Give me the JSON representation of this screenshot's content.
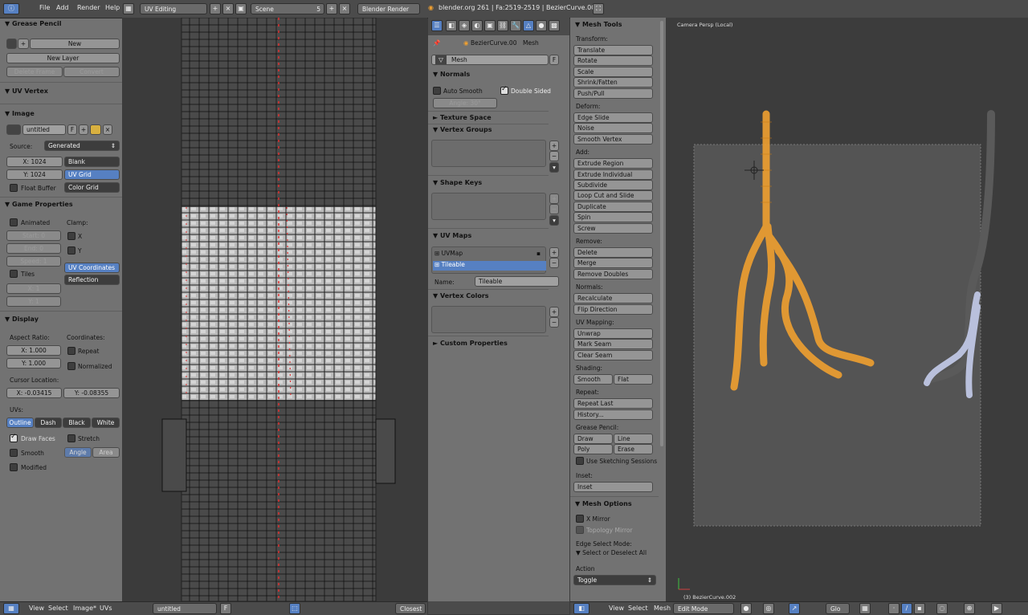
{
  "topbar": {
    "menus": [
      "File",
      "Add",
      "Render",
      "Help"
    ],
    "screen_layout": "UV Editing",
    "scene": "Scene",
    "scene_users": "5",
    "render_engine": "Blender Render",
    "stats": "blender.org 261 | Fa:2519-2519 | BezierCurve.002"
  },
  "uv_tools": {
    "grease_pencil": {
      "header": "▼ Grease Pencil",
      "new": "New",
      "new_layer": "New Layer",
      "delete_frame": "Delete Frame",
      "convert": "Convert"
    },
    "uv_vertex": {
      "header": "▼ UV Vertex"
    },
    "image": {
      "header": "▼ Image",
      "name": "untitled",
      "f": "F",
      "source_label": "Source:",
      "source_value": "Generated",
      "x": "X: 1024",
      "y": "Y: 1024",
      "types": [
        "Blank",
        "UV Grid",
        "Color Grid"
      ],
      "float_buffer": "Float Buffer"
    },
    "game_properties": {
      "header": "▼ Game Properties",
      "animated": "Animated",
      "clamp": "Clamp:",
      "start": "Start: 0",
      "end": "End: 0",
      "speed": "Speed: 1",
      "x": "X",
      "y": "Y",
      "uv_coordinates": "UV Coordinates",
      "reflection": "Reflection",
      "tiles": "Tiles",
      "tx": "X: 1",
      "ty": "Y: 1"
    },
    "display": {
      "header": "▼ Display",
      "aspect_ratio": "Aspect Ratio:",
      "coordinates": "Coordinates:",
      "ax": "X: 1.000",
      "ay": "Y: 1.000",
      "repeat": "Repeat",
      "normalized": "Normalized",
      "cursor_location": "Cursor Location:",
      "cx": "X: -0.03415",
      "cy": "Y: -0.08355",
      "uvs": "UVs:",
      "styles": [
        "Outline",
        "Dash",
        "Black",
        "White"
      ],
      "draw_faces": "Draw Faces",
      "stretch": "Stretch",
      "smooth": "Smooth",
      "angle": "Angle",
      "area": "Area",
      "modified": "Modified"
    }
  },
  "uv_header": {
    "menus": [
      "View",
      "Select",
      "Image*",
      "UVs"
    ],
    "image": "untitled",
    "f": "F",
    "snap": "Closest"
  },
  "properties": {
    "breadcrumb": [
      "BezierCurve.00",
      "Mesh"
    ],
    "datablock": "Mesh",
    "f": "F",
    "normals": {
      "header": "▼ Normals",
      "auto_smooth": "Auto Smooth",
      "double_sided": "Double Sided",
      "angle": "Angle: 30°"
    },
    "texture_space": "► Texture Space",
    "vertex_groups": "▼ Vertex Groups",
    "shape_keys": "▼ Shape Keys",
    "uv_maps": {
      "header": "▼ UV Maps",
      "items": [
        "UVMap",
        "Tileable"
      ],
      "name_label": "Name:",
      "name_value": "Tileable"
    },
    "vertex_colors": "▼ Vertex Colors",
    "custom_properties": "► Custom Properties"
  },
  "mesh_tools": {
    "header": "▼ Mesh Tools",
    "transform_label": "Transform:",
    "transform": [
      "Translate",
      "Rotate",
      "Scale",
      "Shrink/Fatten",
      "Push/Pull"
    ],
    "deform_label": "Deform:",
    "deform": [
      "Edge Slide",
      "Noise",
      "Smooth Vertex"
    ],
    "add_label": "Add:",
    "add": [
      "Extrude Region",
      "Extrude Individual",
      "Subdivide",
      "Loop Cut and Slide",
      "Duplicate",
      "Spin",
      "Screw"
    ],
    "remove_label": "Remove:",
    "remove": [
      "Delete",
      "Merge",
      "Remove Doubles"
    ],
    "normals_label": "Normals:",
    "normals": [
      "Recalculate",
      "Flip Direction"
    ],
    "uv_mapping_label": "UV Mapping:",
    "uv_mapping": [
      "Unwrap",
      "Mark Seam",
      "Clear Seam"
    ],
    "shading_label": "Shading:",
    "shading": [
      "Smooth",
      "Flat"
    ],
    "repeat_label": "Repeat:",
    "repeat": [
      "Repeat Last",
      "History..."
    ],
    "grease_label": "Grease Pencil:",
    "grease": [
      "Draw",
      "Line",
      "Poly",
      "Erase"
    ],
    "sketching": "Use Sketching Sessions",
    "inset_label": "Inset:",
    "inset": "Inset",
    "mesh_options": "▼ Mesh Options",
    "x_mirror": "X Mirror",
    "topology_mirror": "Topology Mirror",
    "edge_select_mode": "Edge Select Mode:",
    "select_deselect": "▼ Select or Deselect All",
    "action_label": "Action",
    "action_value": "Toggle"
  },
  "viewport": {
    "title": "Camera Persp (Local)",
    "object_label": "(3) BezierCurve.002",
    "header_menus": [
      "View",
      "Select",
      "Mesh"
    ],
    "mode": "Edit Mode",
    "pivot": "Glo"
  },
  "colors": {
    "accent_blue": "#5680c2",
    "mesh_orange": "#f0a030",
    "seam_red": "#e03030"
  }
}
